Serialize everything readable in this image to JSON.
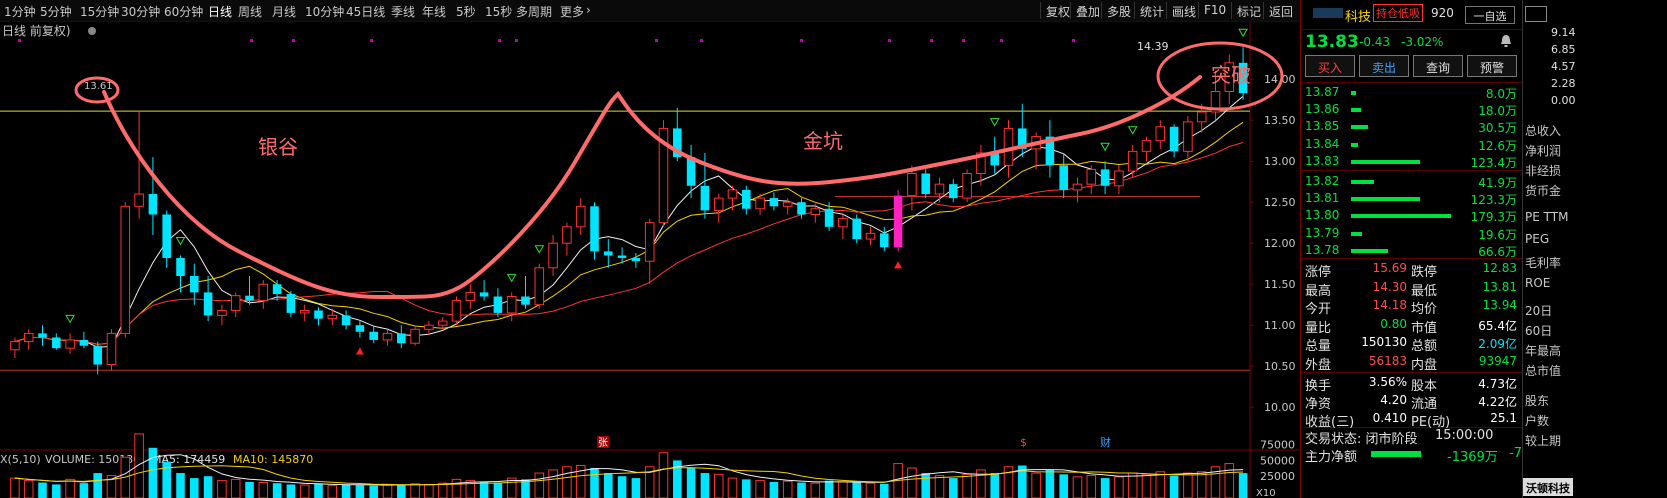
{
  "toolbar": {
    "timeframes": [
      {
        "label": "1分钟",
        "active": false
      },
      {
        "label": "5分钟",
        "active": false
      },
      {
        "label": "15分钟",
        "active": false
      },
      {
        "label": "30分钟",
        "active": false
      },
      {
        "label": "60分钟",
        "active": false
      },
      {
        "label": "日线",
        "active": true
      },
      {
        "label": "周线",
        "active": false
      },
      {
        "label": "月线",
        "active": false
      },
      {
        "label": "10分钟",
        "active": false
      },
      {
        "label": "45日线",
        "active": false
      },
      {
        "label": "季线",
        "active": false
      },
      {
        "label": "年线",
        "active": false
      },
      {
        "label": "5秒",
        "active": false
      },
      {
        "label": "15秒",
        "active": false
      },
      {
        "label": "多周期",
        "active": false
      },
      {
        "label": "更多",
        "active": false
      }
    ],
    "buttons": [
      "复权",
      "叠加",
      "多股",
      "统计",
      "画线",
      "F10",
      "标记",
      "返回"
    ]
  },
  "chart_header": {
    "title": "日线 前复权)",
    "price_labels": {
      "high": "14.39",
      "left_peak": "13.61"
    }
  },
  "annotations": {
    "left": "银谷",
    "middle": "金坑",
    "right": "突破"
  },
  "markers": {
    "zhang": "张",
    "s": "$",
    "cai": "财"
  },
  "volume_header": {
    "indicator": "X(5,10)",
    "volume_label": "VOLUME: 150130",
    "ma5_label": "MA5: 174459",
    "ma10_label": "MA10: 145870"
  },
  "colors": {
    "up": "#ff3030",
    "down": "#00e5ff",
    "ma5": "#f0f0f0",
    "ma10": "#f5d000",
    "ma20": "#ff3333",
    "annotation": "#ff6a6a",
    "highlight": "#ff20c0"
  },
  "chart_data": {
    "type": "candlestick",
    "y_axis_ticks": [
      "14.00",
      "13.50",
      "13.00",
      "12.50",
      "12.00",
      "11.50",
      "11.00",
      "10.50",
      "10.00"
    ],
    "y_range": [
      9.6,
      14.6
    ],
    "volume_ticks": [
      "75000",
      "50000",
      "25000"
    ],
    "volume_range": [
      0,
      95000
    ],
    "reference_lines": [
      13.61,
      12.57,
      10.45
    ],
    "candles": [
      [
        10.7,
        10.85,
        10.6,
        10.8
      ],
      [
        10.8,
        10.95,
        10.7,
        10.9
      ],
      [
        10.9,
        11.0,
        10.75,
        10.85
      ],
      [
        10.85,
        10.9,
        10.7,
        10.72
      ],
      [
        10.72,
        10.9,
        10.65,
        10.82
      ],
      [
        10.82,
        10.92,
        10.72,
        10.75
      ],
      [
        10.75,
        10.8,
        10.4,
        10.52
      ],
      [
        10.52,
        10.95,
        10.45,
        10.9
      ],
      [
        10.9,
        12.5,
        10.85,
        12.45
      ],
      [
        12.45,
        13.61,
        12.3,
        12.6
      ],
      [
        12.6,
        13.05,
        12.1,
        12.35
      ],
      [
        12.35,
        12.4,
        11.7,
        11.82
      ],
      [
        11.82,
        11.85,
        11.4,
        11.6
      ],
      [
        11.6,
        11.75,
        11.25,
        11.4
      ],
      [
        11.4,
        11.6,
        11.05,
        11.12
      ],
      [
        11.12,
        11.25,
        11.0,
        11.18
      ],
      [
        11.18,
        11.4,
        11.1,
        11.36
      ],
      [
        11.36,
        11.6,
        11.25,
        11.3
      ],
      [
        11.3,
        11.55,
        11.2,
        11.5
      ],
      [
        11.5,
        11.55,
        11.3,
        11.38
      ],
      [
        11.38,
        11.42,
        11.1,
        11.15
      ],
      [
        11.15,
        11.25,
        11.05,
        11.18
      ],
      [
        11.18,
        11.22,
        11.0,
        11.08
      ],
      [
        11.08,
        11.2,
        11.0,
        11.12
      ],
      [
        11.12,
        11.18,
        10.95,
        11.0
      ],
      [
        11.0,
        11.05,
        10.85,
        10.92
      ],
      [
        10.92,
        11.0,
        10.78,
        10.82
      ],
      [
        10.82,
        10.95,
        10.75,
        10.9
      ],
      [
        10.9,
        11.0,
        10.72,
        10.78
      ],
      [
        10.78,
        10.98,
        10.75,
        10.95
      ],
      [
        10.95,
        11.05,
        10.88,
        11.0
      ],
      [
        11.0,
        11.1,
        10.95,
        11.05
      ],
      [
        11.05,
        11.35,
        11.0,
        11.3
      ],
      [
        11.3,
        11.5,
        11.2,
        11.4
      ],
      [
        11.4,
        11.55,
        11.3,
        11.35
      ],
      [
        11.35,
        11.45,
        11.1,
        11.15
      ],
      [
        11.15,
        11.4,
        11.05,
        11.35
      ],
      [
        11.35,
        11.6,
        11.2,
        11.25
      ],
      [
        11.25,
        11.75,
        11.2,
        11.7
      ],
      [
        11.7,
        12.1,
        11.6,
        12.0
      ],
      [
        12.0,
        12.25,
        11.85,
        12.2
      ],
      [
        12.2,
        12.55,
        12.1,
        12.45
      ],
      [
        12.45,
        12.5,
        11.8,
        11.9
      ],
      [
        11.9,
        12.05,
        11.7,
        11.85
      ],
      [
        11.85,
        11.95,
        11.75,
        11.82
      ],
      [
        11.82,
        11.88,
        11.7,
        11.78
      ],
      [
        11.78,
        12.3,
        11.5,
        12.25
      ],
      [
        12.25,
        13.5,
        12.2,
        13.4
      ],
      [
        13.4,
        13.65,
        13.0,
        13.05
      ],
      [
        13.05,
        13.2,
        12.55,
        12.7
      ],
      [
        12.7,
        13.1,
        12.3,
        12.4
      ],
      [
        12.4,
        12.6,
        12.25,
        12.55
      ],
      [
        12.55,
        12.7,
        12.4,
        12.65
      ],
      [
        12.65,
        12.7,
        12.35,
        12.42
      ],
      [
        12.42,
        12.6,
        12.35,
        12.55
      ],
      [
        12.55,
        12.62,
        12.4,
        12.45
      ],
      [
        12.45,
        12.55,
        12.35,
        12.5
      ],
      [
        12.5,
        12.55,
        12.3,
        12.35
      ],
      [
        12.35,
        12.48,
        12.25,
        12.42
      ],
      [
        12.42,
        12.5,
        12.15,
        12.2
      ],
      [
        12.2,
        12.35,
        12.05,
        12.3
      ],
      [
        12.3,
        12.35,
        12.0,
        12.05
      ],
      [
        12.05,
        12.2,
        11.98,
        12.12
      ],
      [
        12.12,
        12.2,
        11.9,
        11.95
      ],
      [
        11.95,
        12.65,
        11.9,
        12.58
      ],
      [
        12.58,
        12.95,
        12.4,
        12.85
      ],
      [
        12.85,
        12.9,
        12.55,
        12.6
      ],
      [
        12.6,
        12.8,
        12.5,
        12.72
      ],
      [
        12.72,
        12.78,
        12.5,
        12.55
      ],
      [
        12.55,
        12.9,
        12.5,
        12.85
      ],
      [
        12.85,
        13.2,
        12.7,
        13.1
      ],
      [
        13.1,
        13.3,
        12.85,
        12.95
      ],
      [
        12.95,
        13.5,
        12.8,
        13.4
      ],
      [
        13.4,
        13.7,
        13.05,
        13.15
      ],
      [
        13.15,
        13.35,
        12.9,
        13.3
      ],
      [
        13.3,
        13.5,
        12.8,
        12.95
      ],
      [
        12.95,
        13.1,
        12.55,
        12.65
      ],
      [
        12.65,
        12.8,
        12.5,
        12.72
      ],
      [
        12.72,
        12.95,
        12.6,
        12.9
      ],
      [
        12.9,
        13.0,
        12.6,
        12.7
      ],
      [
        12.7,
        12.95,
        12.6,
        12.88
      ],
      [
        12.88,
        13.2,
        12.8,
        13.12
      ],
      [
        13.12,
        13.3,
        13.0,
        13.25
      ],
      [
        13.25,
        13.5,
        13.15,
        13.42
      ],
      [
        13.42,
        13.45,
        13.05,
        13.12
      ],
      [
        13.12,
        13.55,
        13.0,
        13.48
      ],
      [
        13.48,
        13.7,
        13.35,
        13.6
      ],
      [
        13.6,
        14.1,
        13.5,
        13.85
      ],
      [
        13.85,
        14.3,
        13.7,
        14.2
      ],
      [
        14.2,
        14.39,
        13.75,
        13.83
      ]
    ],
    "volumes": [
      22000,
      18000,
      15000,
      12000,
      20000,
      14000,
      30000,
      26000,
      55000,
      92000,
      70000,
      48000,
      30000,
      22000,
      25000,
      18000,
      20000,
      16000,
      15000,
      14000,
      12000,
      11000,
      13000,
      10000,
      12000,
      11000,
      10000,
      12000,
      11000,
      13000,
      12000,
      14000,
      20000,
      18000,
      16000,
      15000,
      22000,
      20000,
      30000,
      35000,
      40000,
      42000,
      38000,
      30000,
      25000,
      22000,
      40000,
      62000,
      50000,
      38000,
      30000,
      28000,
      22000,
      20000,
      18000,
      16000,
      17000,
      15000,
      14000,
      18000,
      16000,
      15000,
      14000,
      13000,
      45000,
      38000,
      30000,
      26000,
      22000,
      28000,
      35000,
      30000,
      40000,
      42000,
      30000,
      35000,
      28000,
      24000,
      26000,
      22000,
      24000,
      30000,
      28000,
      32000,
      26000,
      30000,
      32000,
      40000,
      45000,
      30000
    ]
  },
  "panel": {
    "stock_name": "科技",
    "code_tail": "920",
    "badge": "持仓低吸",
    "self_select": "一自选",
    "price": "13.83",
    "change": "-0.43",
    "change_pct": "-3.02%",
    "buttons": [
      "买入",
      "卖出",
      "查询",
      "预警"
    ],
    "order_book": [
      {
        "price": "13.87",
        "vol": "8.0万",
        "bar": 0.05
      },
      {
        "price": "13.86",
        "vol": "18.0万",
        "bar": 0.1
      },
      {
        "price": "13.85",
        "vol": "30.5万",
        "bar": 0.17
      },
      {
        "price": "13.84",
        "vol": "12.6万",
        "bar": 0.07
      },
      {
        "price": "13.83",
        "vol": "123.4万",
        "bar": 0.69
      },
      {
        "price": "13.82",
        "vol": "41.9万",
        "bar": 0.23
      },
      {
        "price": "13.81",
        "vol": "123.3万",
        "bar": 0.69
      },
      {
        "price": "13.80",
        "vol": "179.3万",
        "bar": 1.0
      },
      {
        "price": "13.79",
        "vol": "19.6万",
        "bar": 0.11
      },
      {
        "price": "13.78",
        "vol": "66.6万",
        "bar": 0.37
      }
    ],
    "stats": [
      {
        "l1": "涨停",
        "v1": "15.69",
        "c1": "red",
        "l2": "跌停",
        "v2": "12.83",
        "c2": "grn"
      },
      {
        "l1": "最高",
        "v1": "14.30",
        "c1": "red",
        "l2": "最低",
        "v2": "13.81",
        "c2": "grn"
      },
      {
        "l1": "今开",
        "v1": "14.18",
        "c1": "red",
        "l2": "均价",
        "v2": "13.94",
        "c2": "grn"
      },
      {
        "l1": "量比",
        "v1": "0.80",
        "c1": "grn",
        "l2": "市值",
        "v2": "65.4亿",
        "c2": "wht"
      },
      {
        "l1": "总量",
        "v1": "150130",
        "c1": "wht",
        "l2": "总额",
        "v2": "2.09亿",
        "c2": "cyan"
      },
      {
        "l1": "外盘",
        "v1": "56183",
        "c1": "red",
        "l2": "内盘",
        "v2": "93947",
        "c2": "grn"
      }
    ],
    "stats2": [
      {
        "l1": "换手",
        "v1": "3.56%",
        "c1": "wht",
        "l2": "股本",
        "v2": "4.73亿",
        "c2": "wht"
      },
      {
        "l1": "净资",
        "v1": "4.20",
        "c1": "wht",
        "l2": "流通",
        "v2": "4.22亿",
        "c2": "wht"
      },
      {
        "l1": "收益(三)",
        "v1": "0.410",
        "c1": "wht",
        "l2": "PE(动)",
        "v2": "25.1",
        "c2": "wht"
      }
    ],
    "trade_state_label": "交易状态: 闭市阶段",
    "trade_time": "15:00:00",
    "main_flow_label": "主力净额",
    "main_flow_value": "-1369万",
    "main_flow_tail": "-7"
  },
  "far_right": {
    "scale": [
      "9.14",
      "6.85",
      "4.57",
      "2.28",
      "0.00"
    ],
    "items": [
      "总收入",
      "净利润",
      "非经损",
      "货币金",
      "PE TTM",
      "PEG",
      "毛利率",
      "ROE",
      "20日",
      "60日",
      "年最高",
      "总市值",
      "股东",
      "户数",
      "较上期"
    ],
    "footer": "沃顿科技"
  }
}
